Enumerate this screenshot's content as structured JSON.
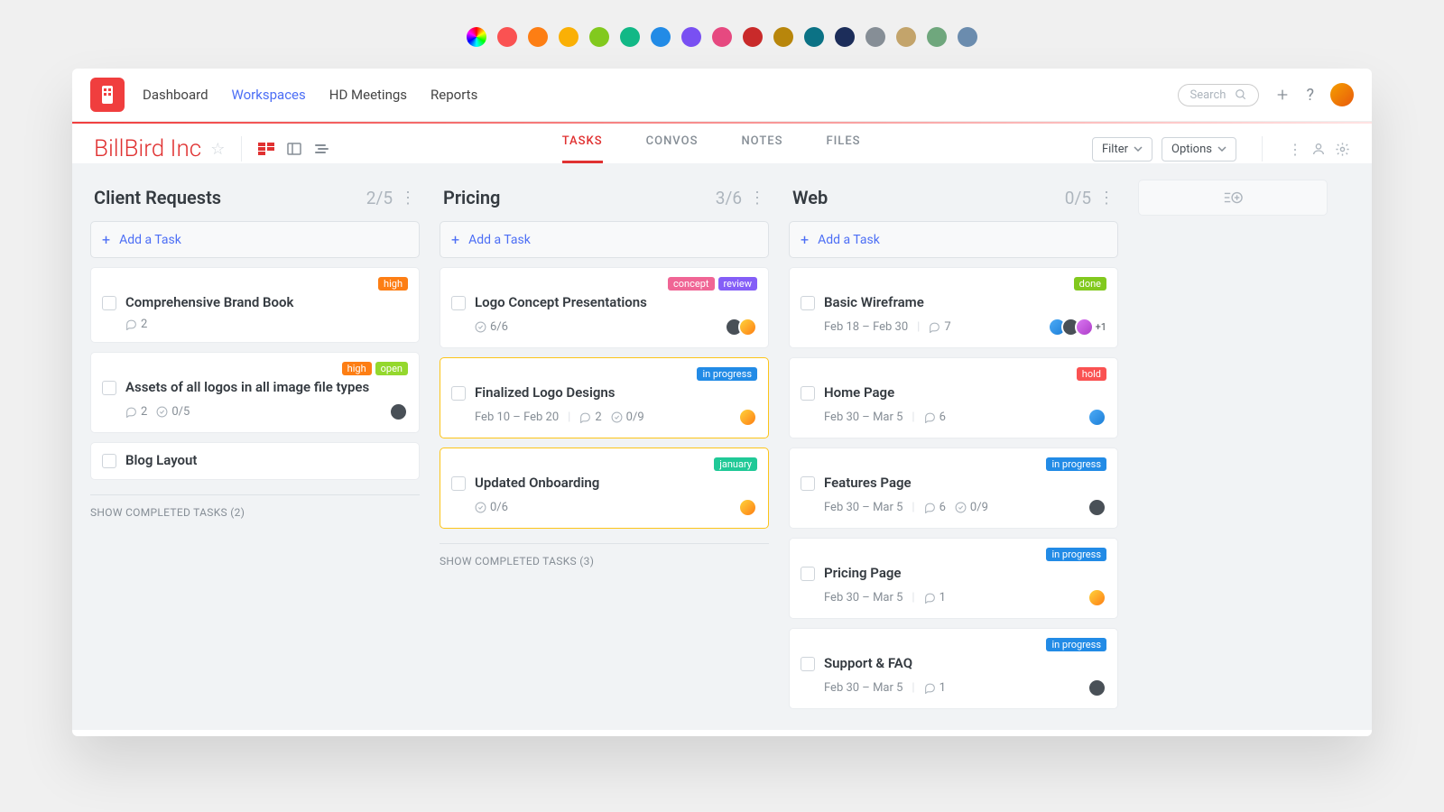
{
  "colorPalette": [
    "conic-gradient(red,yellow,lime,cyan,blue,magenta,red)",
    "#fa5252",
    "#fd7e14",
    "#fab005",
    "#82c91e",
    "#12b886",
    "#228be6",
    "#7950f2",
    "#e64980",
    "#c92a2a",
    "#b8860b",
    "#0b7285",
    "#1c2d5a",
    "#868e96",
    "#c3a46b",
    "#6fa77d",
    "#6b8cae"
  ],
  "nav": {
    "items": [
      {
        "label": "Dashboard",
        "active": false
      },
      {
        "label": "Workspaces",
        "active": true
      },
      {
        "label": "HD Meetings",
        "active": false
      },
      {
        "label": "Reports",
        "active": false
      }
    ]
  },
  "search": {
    "placeholder": "Search"
  },
  "workspace": {
    "title": "BillBird Inc"
  },
  "tabs": [
    {
      "label": "TASKS",
      "active": true
    },
    {
      "label": "CONVOS",
      "active": false
    },
    {
      "label": "NOTES",
      "active": false
    },
    {
      "label": "FILES",
      "active": false
    }
  ],
  "controls": {
    "filter": "Filter",
    "options": "Options"
  },
  "addTaskLabel": "Add a Task",
  "columns": [
    {
      "title": "Client Requests",
      "count": "2/5",
      "showCompleted": "SHOW COMPLETED TASKS (2)",
      "cards": [
        {
          "tags": [
            {
              "text": "high",
              "cls": "high"
            }
          ],
          "title": "Comprehensive Brand Book",
          "meta": {
            "comments": "2"
          }
        },
        {
          "tags": [
            {
              "text": "high",
              "cls": "high"
            },
            {
              "text": "open",
              "cls": "open"
            }
          ],
          "title": "Assets of all logos in all image file types",
          "meta": {
            "comments": "2",
            "check": "0/5"
          },
          "avatars": [
            "a4"
          ]
        },
        {
          "tags": [],
          "title": "Blog Layout"
        }
      ]
    },
    {
      "title": "Pricing",
      "count": "3/6",
      "showCompleted": "SHOW COMPLETED TASKS (3)",
      "cards": [
        {
          "tags": [
            {
              "text": "concept",
              "cls": "concept"
            },
            {
              "text": "review",
              "cls": "review"
            }
          ],
          "title": "Logo Concept Presentations",
          "meta": {
            "check": "6/6"
          },
          "avatars": [
            "a4",
            "a1"
          ]
        },
        {
          "tags": [
            {
              "text": "in progress",
              "cls": "progress"
            }
          ],
          "title": "Finalized Logo Designs",
          "meta": {
            "dates": "Feb 10 – Feb 20",
            "comments": "2",
            "check": "0/9"
          },
          "avatars": [
            "a1"
          ],
          "highlight": true
        },
        {
          "tags": [
            {
              "text": "january",
              "cls": "january"
            }
          ],
          "title": "Updated Onboarding",
          "meta": {
            "check": "0/6"
          },
          "avatars": [
            "a1"
          ],
          "highlight": true
        }
      ]
    },
    {
      "title": "Web",
      "count": "0/5",
      "cards": [
        {
          "tags": [
            {
              "text": "done",
              "cls": "done"
            }
          ],
          "title": "Basic Wireframe",
          "meta": {
            "dates": "Feb 18 – Feb 30",
            "comments": "7"
          },
          "avatars": [
            "a2",
            "a4",
            "a3"
          ],
          "moreAvatars": "+1"
        },
        {
          "tags": [
            {
              "text": "hold",
              "cls": "hold"
            }
          ],
          "title": "Home Page",
          "meta": {
            "dates": "Feb 30 – Mar 5",
            "comments": "6"
          },
          "avatars": [
            "a2"
          ]
        },
        {
          "tags": [
            {
              "text": "in progress",
              "cls": "progress"
            }
          ],
          "title": "Features Page",
          "meta": {
            "dates": "Feb 30 – Mar 5",
            "comments": "6",
            "check": "0/9"
          },
          "avatars": [
            "a4"
          ]
        },
        {
          "tags": [
            {
              "text": "in progress",
              "cls": "progress"
            }
          ],
          "title": "Pricing Page",
          "meta": {
            "dates": "Feb 30 – Mar 5",
            "comments": "1"
          },
          "avatars": [
            "a1"
          ]
        },
        {
          "tags": [
            {
              "text": "in progress",
              "cls": "progress"
            }
          ],
          "title": "Support & FAQ",
          "meta": {
            "dates": "Feb 30 – Mar 5",
            "comments": "1"
          },
          "avatars": [
            "a4"
          ]
        }
      ]
    }
  ]
}
